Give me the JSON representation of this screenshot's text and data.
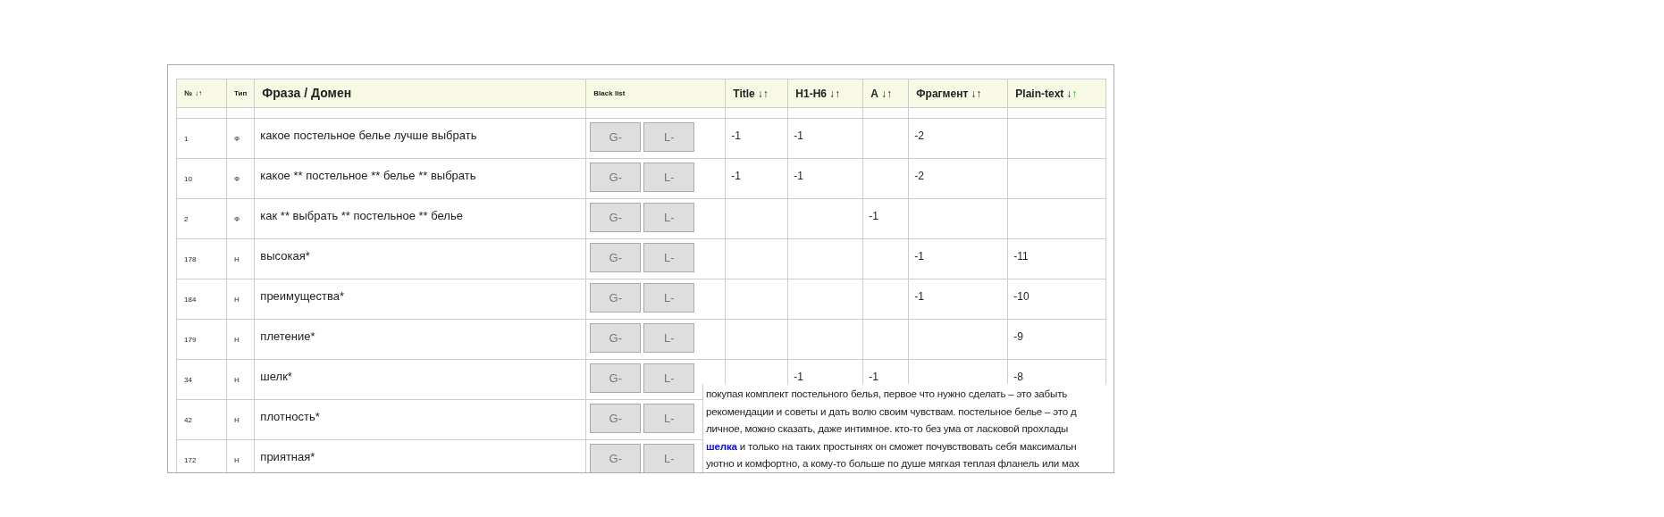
{
  "table": {
    "columns": [
      {
        "label": "№",
        "kind": "small",
        "sort": [
          {
            "glyph": "↓",
            "selected": false
          },
          {
            "glyph": "↑",
            "selected": false
          }
        ]
      },
      {
        "label": "Тип",
        "kind": "small"
      },
      {
        "label": "Фраза / Домен",
        "kind": "large"
      },
      {
        "label": "Black list",
        "kind": "small"
      },
      {
        "label": "Title",
        "kind": "medium",
        "sort": [
          {
            "glyph": "↓",
            "selected": false
          },
          {
            "glyph": "↑",
            "selected": false
          }
        ]
      },
      {
        "label": "H1-H6",
        "kind": "medium",
        "sort": [
          {
            "glyph": "↓",
            "selected": false
          },
          {
            "glyph": "↑",
            "selected": false
          }
        ]
      },
      {
        "label": "A",
        "kind": "medium",
        "sort": [
          {
            "glyph": "↓",
            "selected": false
          },
          {
            "glyph": "↑",
            "selected": false
          }
        ]
      },
      {
        "label": "Фрагмент",
        "kind": "medium",
        "sort": [
          {
            "glyph": "↓",
            "selected": false
          },
          {
            "glyph": "↑",
            "selected": false
          }
        ]
      },
      {
        "label": "Plain-text",
        "kind": "medium",
        "sort": [
          {
            "glyph": "↓",
            "selected": false
          },
          {
            "glyph": "↑",
            "selected": true
          }
        ]
      }
    ],
    "rows": [
      {
        "num": "1",
        "type": "Ф",
        "phrase": "какое постельное белье лучше выбрать",
        "buttons": [
          "G-",
          "L-"
        ],
        "values": {
          "title": "-1",
          "h1": "-1",
          "fragment": "-2"
        }
      },
      {
        "num": "10",
        "type": "Ф",
        "phrase": "какое ** постельное ** белье ** выбрать",
        "buttons": [
          "G-",
          "L-"
        ],
        "values": {
          "title": "-1",
          "h1": "-1",
          "fragment": "-2"
        }
      },
      {
        "num": "2",
        "type": "Ф",
        "phrase": "как ** выбрать ** постельное ** белье",
        "buttons": [
          "G-",
          "L-"
        ],
        "values": {
          "a": "-1"
        }
      },
      {
        "num": "178",
        "type": "Н",
        "phrase": "высокая*",
        "buttons": [
          "G-",
          "L-"
        ],
        "values": {
          "fragment": "-1",
          "plain": "-11"
        }
      },
      {
        "num": "184",
        "type": "Н",
        "phrase": "преимущества*",
        "buttons": [
          "G-",
          "L-"
        ],
        "values": {
          "fragment": "-1",
          "plain": "-10"
        }
      },
      {
        "num": "179",
        "type": "Н",
        "phrase": "плетение*",
        "buttons": [
          "G-",
          "L-"
        ],
        "values": {
          "plain": "-9"
        }
      },
      {
        "num": "34",
        "type": "Н",
        "phrase": "шелк*",
        "buttons": [
          "G-",
          "L-"
        ],
        "values": {
          "h1": "-1",
          "a": "-1",
          "plain": "-8"
        }
      },
      {
        "num": "42",
        "type": "Н",
        "phrase": "плотность*",
        "buttons": [
          "G-",
          "L-"
        ]
      },
      {
        "num": "172",
        "type": "Н",
        "phrase": "приятная*",
        "buttons": [
          "G-",
          "L-"
        ]
      }
    ]
  },
  "tooltip": {
    "lines": [
      {
        "text": "покупая комплект постельного белья, первое что нужно сделать – это забыть"
      },
      {
        "text": "рекомендации и советы и дать волю своим чувствам. постельное белье – это д"
      },
      {
        "text": "личное, можно сказать, даже интимное. кто-то без ума от ласковой прохлады"
      },
      {
        "link": "шелка",
        "text": "и только на таких простынях он сможет почувствовать себя максимальн"
      },
      {
        "text": "уютно и комфортно, а кому-то больше по душе мягкая теплая фланель или мах"
      }
    ]
  }
}
